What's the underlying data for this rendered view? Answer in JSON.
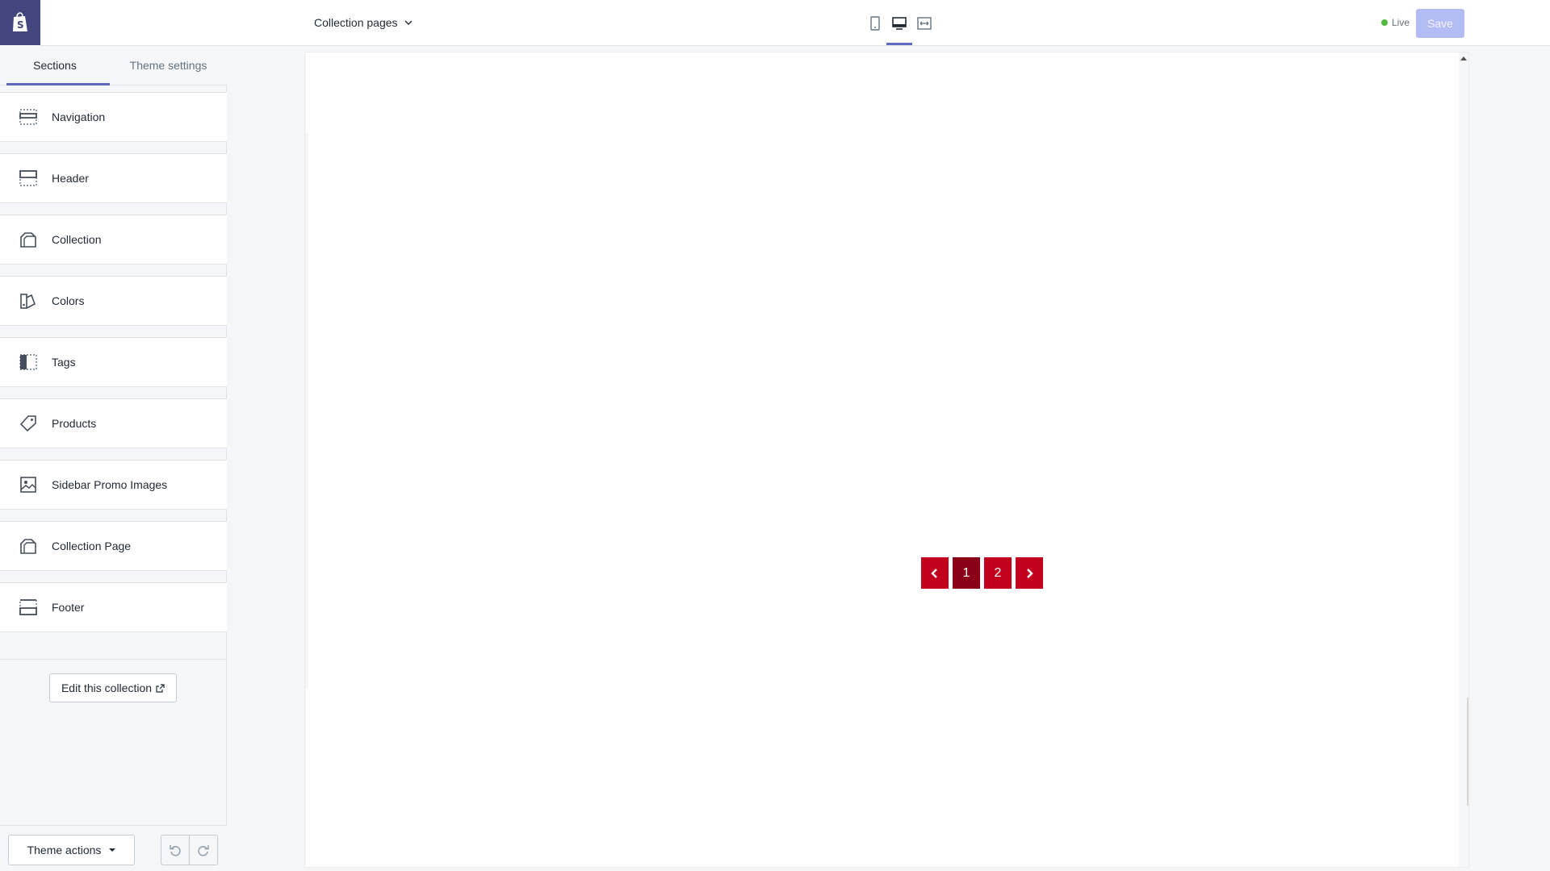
{
  "sidebar": {
    "tabs": [
      {
        "label": "Sections",
        "active": true
      },
      {
        "label": "Theme settings",
        "active": false
      }
    ],
    "sections": [
      {
        "label": "Navigation",
        "icon": "navigation-section-icon"
      },
      {
        "label": "Header",
        "icon": "header-section-icon"
      },
      {
        "label": "Collection",
        "icon": "collection-icon"
      },
      {
        "label": "Colors",
        "icon": "colors-icon"
      },
      {
        "label": "Tags",
        "icon": "tags-sidebar-icon"
      },
      {
        "label": "Products",
        "icon": "tag-icon"
      },
      {
        "label": "Sidebar Promo Images",
        "icon": "image-icon"
      },
      {
        "label": "Collection Page",
        "icon": "collection-icon"
      },
      {
        "label": "Footer",
        "icon": "footer-section-icon"
      }
    ],
    "edit_collection_label": "Edit this collection",
    "theme_actions_label": "Theme actions"
  },
  "topbar": {
    "page_select_label": "Collection pages",
    "live_label": "Live",
    "save_label": "Save",
    "active_device": "desktop"
  },
  "preview": {
    "pagination": {
      "prev_label": "‹",
      "pages": [
        "1",
        "2"
      ],
      "current_page": "1",
      "next_label": "›"
    }
  },
  "colors": {
    "accent": "#5c6ac4",
    "logo_bg": "#43467f",
    "live_dot": "#50b83c",
    "pagination": "#c4001f",
    "pagination_current": "#8a0016"
  }
}
